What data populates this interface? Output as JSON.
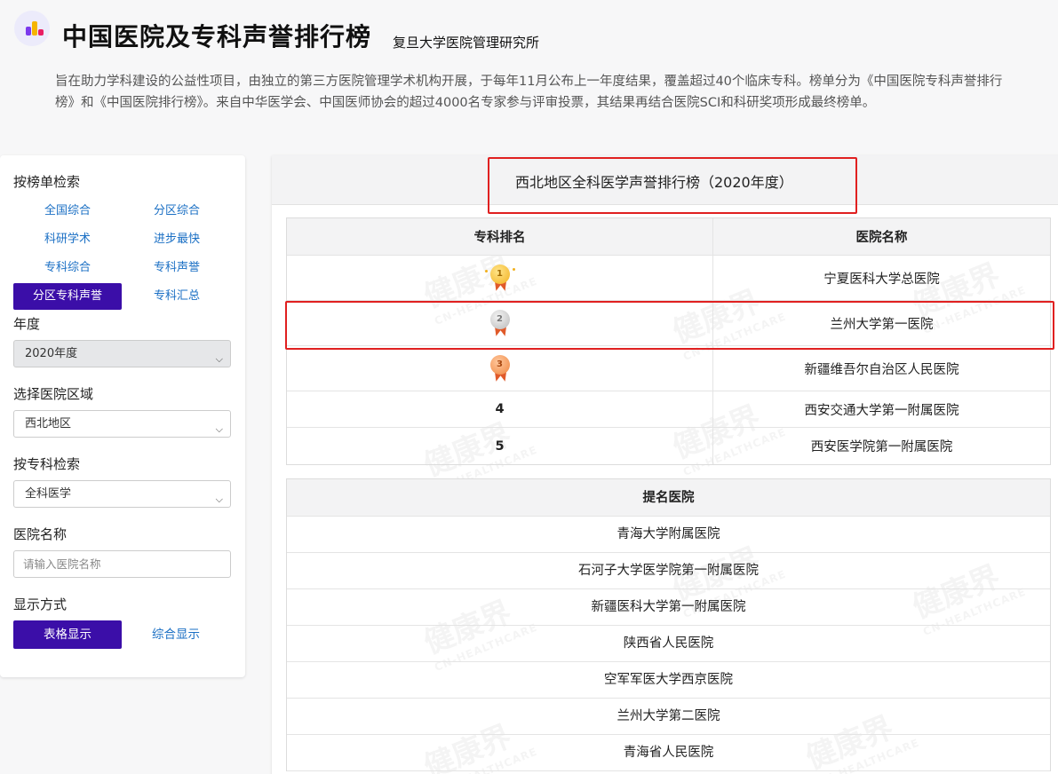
{
  "header": {
    "title": "中国医院及专科声誉排行榜",
    "subtitle": "复旦大学医院管理研究所",
    "intro": "旨在助力学科建设的公益性项目，由独立的第三方医院管理学术机构开展，于每年11月公布上一年度结果，覆盖超过40个临床专科。榜单分为《中国医院专科声誉排行榜》和《中国医院排行榜》。来自中华医学会、中国医师协会的超过4000名专家参与评审投票，其结果再结合医院SCI和科研奖项形成最终榜单。"
  },
  "sidebar": {
    "search_by_list_label": "按榜单检索",
    "nav": [
      {
        "label": "全国综合",
        "active": false
      },
      {
        "label": "分区综合",
        "active": false
      },
      {
        "label": "科研学术",
        "active": false
      },
      {
        "label": "进步最快",
        "active": false
      },
      {
        "label": "专科综合",
        "active": false
      },
      {
        "label": "专科声誉",
        "active": false
      },
      {
        "label": "分区专科声誉",
        "active": true
      },
      {
        "label": "专科汇总",
        "active": false
      }
    ],
    "year_label": "年度",
    "year_value": "2020年度",
    "region_label": "选择医院区域",
    "region_value": "西北地区",
    "specialty_label": "按专科检索",
    "specialty_value": "全科医学",
    "hospital_label": "医院名称",
    "hospital_placeholder": "请输入医院名称",
    "display_label": "显示方式",
    "display_table": "表格显示",
    "display_combined": "综合显示"
  },
  "main": {
    "title": "西北地区全科医学声誉排行榜（2020年度）",
    "table_headers": {
      "rank": "专科排名",
      "name": "医院名称"
    },
    "rankings": [
      {
        "rank": "1",
        "name": "宁夏医科大学总医院",
        "medal": "gold"
      },
      {
        "rank": "2",
        "name": "兰州大学第一医院",
        "medal": "silver"
      },
      {
        "rank": "3",
        "name": "新疆维吾尔自治区人民医院",
        "medal": "bronze"
      },
      {
        "rank": "4",
        "name": "西安交通大学第一附属医院",
        "medal": ""
      },
      {
        "rank": "5",
        "name": "西安医学院第一附属医院",
        "medal": ""
      }
    ],
    "nominated_header": "提名医院",
    "nominated": [
      "青海大学附属医院",
      "石河子大学医学院第一附属医院",
      "新疆医科大学第一附属医院",
      "陕西省人民医院",
      "空军军医大学西京医院",
      "兰州大学第二医院",
      "青海省人民医院"
    ]
  },
  "watermark": {
    "cn": "健康界",
    "en": "CN-HEALTHCARE"
  },
  "colors": {
    "accent": "#3b0ea8",
    "link": "#1a6fc4",
    "highlight": "#e02020"
  }
}
